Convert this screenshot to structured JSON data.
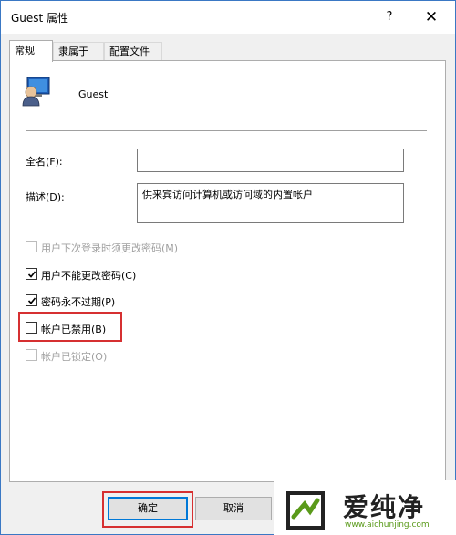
{
  "window": {
    "title": "Guest 属性",
    "help": "?",
    "close": "✕"
  },
  "tabs": [
    {
      "label": "常规",
      "active": true
    },
    {
      "label": "隶属于",
      "active": false
    },
    {
      "label": "配置文件",
      "active": false
    }
  ],
  "user": {
    "name": "Guest",
    "icon": "user-account-icon"
  },
  "fields": {
    "full_name": {
      "label": "全名(F):",
      "value": ""
    },
    "description": {
      "label": "描述(D):",
      "value": "供来宾访问计算机或访问域的内置帐户"
    }
  },
  "checkboxes": [
    {
      "label": "用户下次登录时须更改密码(M)",
      "checked": false,
      "disabled": true
    },
    {
      "label": "用户不能更改密码(C)",
      "checked": true,
      "disabled": false
    },
    {
      "label": "密码永不过期(P)",
      "checked": true,
      "disabled": false
    },
    {
      "label": "帐户已禁用(B)",
      "checked": false,
      "disabled": false,
      "highlighted": true
    },
    {
      "label": "帐户已锁定(O)",
      "checked": false,
      "disabled": true
    }
  ],
  "buttons": {
    "ok": "确定",
    "cancel": "取消"
  },
  "watermark": {
    "text": "爱纯净",
    "url": "www.aichunjing.com"
  },
  "colors": {
    "accent": "#0078d7",
    "highlight": "#d63031",
    "watermark_green": "#5a9a1a"
  }
}
